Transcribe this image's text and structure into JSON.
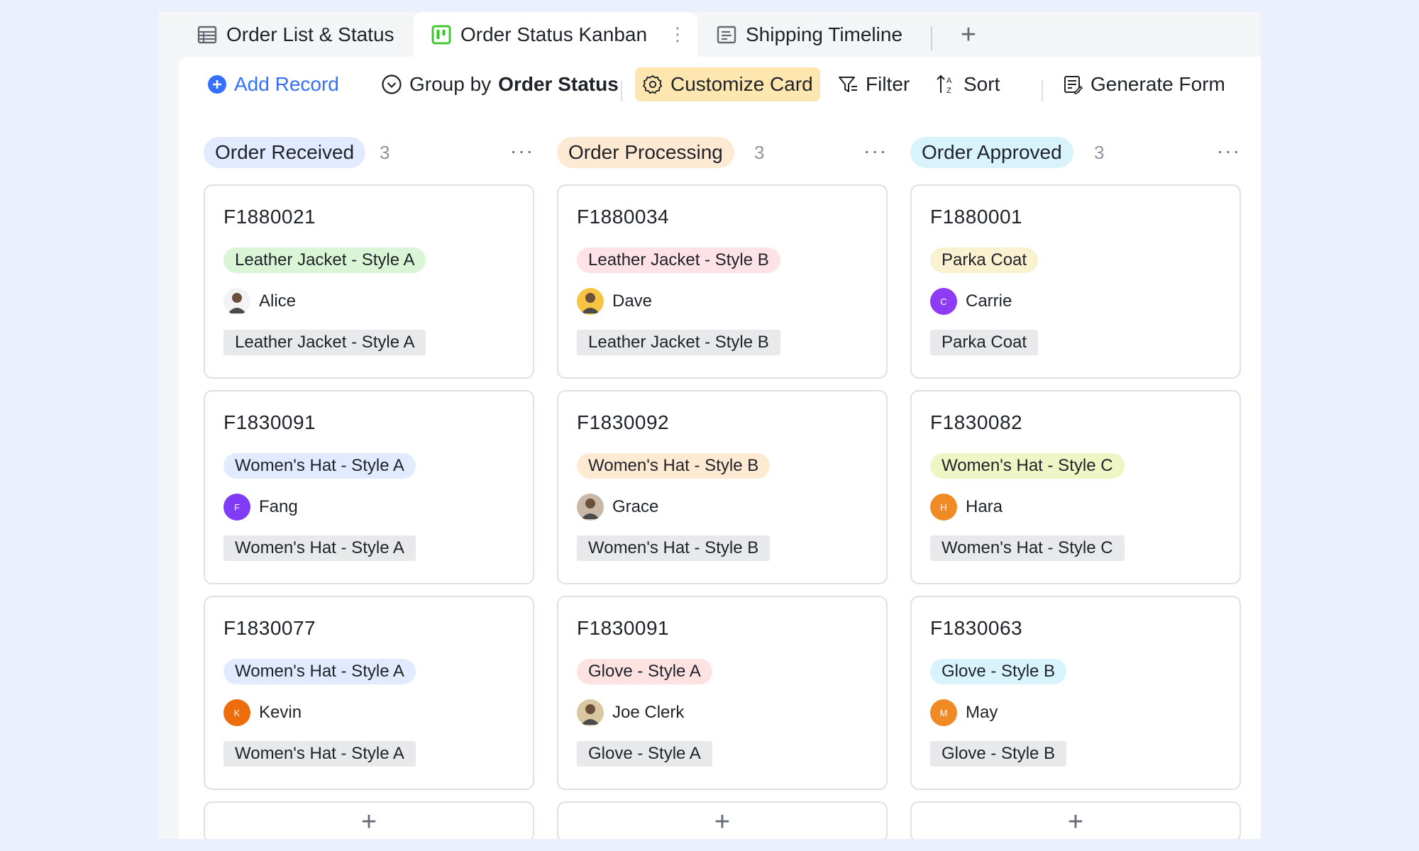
{
  "tabs": [
    {
      "label": "Order List & Status",
      "icon": "table-icon"
    },
    {
      "label": "Order Status Kanban",
      "icon": "kanban-icon",
      "active": true
    },
    {
      "label": "Shipping Timeline",
      "icon": "timeline-icon"
    }
  ],
  "tab_more": "⋮",
  "tab_add": "+",
  "toolbar": {
    "add_record": "Add Record",
    "group_prefix": "Group by",
    "group_field": "Order Status",
    "customize": "Customize Card",
    "filter": "Filter",
    "sort": "Sort",
    "generate_form": "Generate Form"
  },
  "colors": {
    "accent": "#3370ff",
    "customize_bg": "#fde6b0",
    "background": "#eaf0fc"
  },
  "columns": [
    {
      "title": "Order Received",
      "count": "3",
      "title_bg": "#e1eaff",
      "more": "···",
      "cards": [
        {
          "id": "F1880021",
          "tag": "Leather Jacket - Style A",
          "tag_bg": "#d9f5d6",
          "user": "Alice",
          "avatar": "photo-avatar",
          "avatar_color": "#f2f3f5",
          "avatar_letter": "",
          "box": "Leather Jacket - Style A"
        },
        {
          "id": "F1830091",
          "tag": "Women's Hat - Style A",
          "tag_bg": "#e1eaff",
          "user": "Fang",
          "avatar": "letter-avatar",
          "avatar_color": "#7f3bf5",
          "avatar_letter": "F",
          "box": "Women's Hat - Style A"
        },
        {
          "id": "F1830077",
          "tag": "Women's Hat - Style A",
          "tag_bg": "#e1eaff",
          "user": "Kevin",
          "avatar": "letter-avatar",
          "avatar_color": "#ed6d0c",
          "avatar_letter": "K",
          "box": "Women's Hat - Style A"
        }
      ],
      "add": "+"
    },
    {
      "title": "Order Processing",
      "count": "3",
      "title_bg": "#feead2",
      "more": "···",
      "cards": [
        {
          "id": "F1880034",
          "tag": "Leather Jacket - Style B",
          "tag_bg": "#fde2e8",
          "user": "Dave",
          "avatar": "photo-avatar",
          "avatar_color": "#f6c343",
          "avatar_letter": "",
          "box": "Leather Jacket - Style B"
        },
        {
          "id": "F1830092",
          "tag": "Women's Hat - Style B",
          "tag_bg": "#feead2",
          "user": "Grace",
          "avatar": "photo-avatar",
          "avatar_color": "#c9b8a8",
          "avatar_letter": "",
          "box": "Women's Hat - Style B"
        },
        {
          "id": "F1830091",
          "tag": "Glove - Style A",
          "tag_bg": "#fde2e2",
          "user": "Joe Clerk",
          "avatar": "photo-avatar",
          "avatar_color": "#d8c7a0",
          "avatar_letter": "",
          "box": "Glove - Style A"
        }
      ],
      "add": "+"
    },
    {
      "title": "Order Approved",
      "count": "3",
      "title_bg": "#d9f3fd",
      "more": "···",
      "cards": [
        {
          "id": "F1880001",
          "tag": "Parka Coat",
          "tag_bg": "#faf1d1",
          "user": "Carrie",
          "avatar": "letter-avatar",
          "avatar_color": "#8d3bf5",
          "avatar_letter": "C",
          "box": "Parka Coat"
        },
        {
          "id": "F1830082",
          "tag": "Women's Hat - Style C",
          "tag_bg": "#eef6c6",
          "user": "Hara",
          "avatar": "letter-avatar",
          "avatar_color": "#f08a24",
          "avatar_letter": "H",
          "box": "Women's Hat - Style C"
        },
        {
          "id": "F1830063",
          "tag": "Glove - Style B",
          "tag_bg": "#d9f3fd",
          "user": "May",
          "avatar": "letter-avatar",
          "avatar_color": "#f08a24",
          "avatar_letter": "M",
          "box": "Glove - Style B"
        }
      ],
      "add": "+"
    }
  ]
}
